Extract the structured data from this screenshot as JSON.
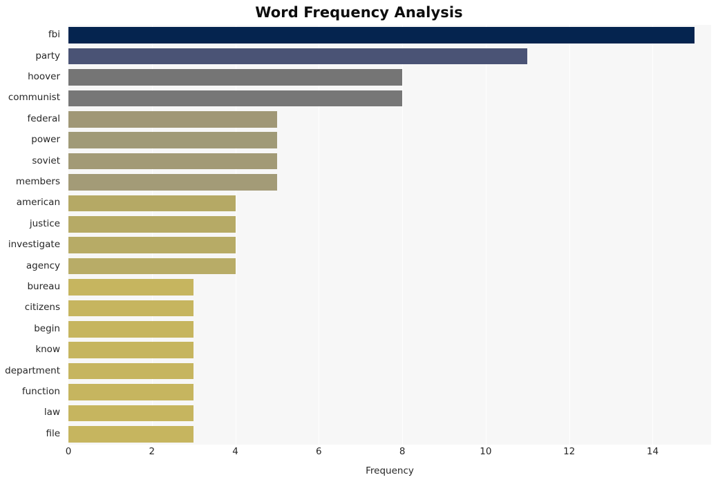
{
  "chart_data": {
    "type": "bar",
    "orientation": "horizontal",
    "title": "Word Frequency Analysis",
    "xlabel": "Frequency",
    "ylabel": "",
    "categories": [
      "fbi",
      "party",
      "hoover",
      "communist",
      "federal",
      "power",
      "soviet",
      "members",
      "american",
      "justice",
      "investigate",
      "agency",
      "bureau",
      "citizens",
      "begin",
      "know",
      "department",
      "function",
      "law",
      "file"
    ],
    "values": [
      15,
      11,
      8,
      8,
      5,
      5,
      5,
      5,
      4,
      4,
      4,
      4,
      3,
      3,
      3,
      3,
      3,
      3,
      3,
      3
    ],
    "bar_colors": [
      "#05244f",
      "#4a5375",
      "#757575",
      "#777777",
      "#a09776",
      "#a09a77",
      "#a29a76",
      "#a39b77",
      "#b5a965",
      "#b6aa66",
      "#b7ab66",
      "#b8ac67",
      "#c6b55f",
      "#c6b55f",
      "#c6b55f",
      "#c6b55f",
      "#c6b55f",
      "#c6b55f",
      "#c6b55f",
      "#c6b55f"
    ],
    "xlim": [
      0,
      15.4
    ],
    "xticks": [
      0,
      2,
      4,
      6,
      8,
      10,
      12,
      14
    ],
    "xtick_labels": [
      "0",
      "2",
      "4",
      "6",
      "8",
      "10",
      "12",
      "14"
    ],
    "grid": true,
    "grid_axis": "x",
    "grid_color": "#ffffff",
    "plot_background": "#f7f7f7",
    "figure_background": "#ffffff",
    "legend": null,
    "legend_position": "none"
  }
}
